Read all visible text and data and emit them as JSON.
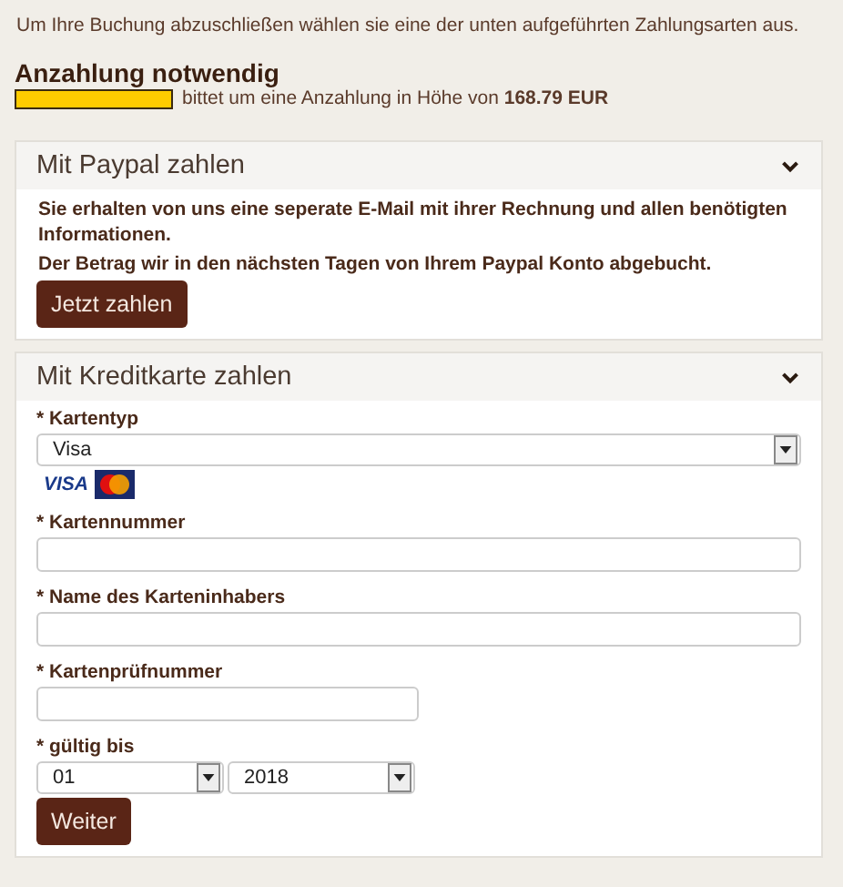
{
  "intro": "Um Ihre Buchung abzuschließen wählen sie eine der unten aufgeführten Zahlungsarten aus.",
  "deposit": {
    "title": "Anzahlung notwendig",
    "redacted": true,
    "text": "bittet um eine Anzahlung in Höhe von **168.79 EUR**"
  },
  "panels": [
    {
      "title": "Mit Paypal zahlen",
      "expanded": true,
      "paragraphs": [
        "Sie erhalten von uns eine seperate E-Mail mit ihrer Rechnung und allen benötigten Informationen.",
        "Der Betrag wir in den nächsten Tagen von Ihrem Paypal Konto abgebucht."
      ],
      "button": "Jetzt zahlen"
    },
    {
      "title": "Mit Kreditkarte zahlen",
      "expanded": true,
      "fields": [
        {
          "kind": "select",
          "label": "* Kartentyp",
          "value": "Visa"
        },
        {
          "kind": "cards",
          "visa": "VISA"
        },
        {
          "kind": "input",
          "label": "* Kartennummer"
        },
        {
          "kind": "input",
          "label": "* Name des Karteninhabers"
        },
        {
          "kind": "short-input",
          "label": "* Kartenprüfnummer"
        },
        {
          "kind": "date",
          "label": "* gültig bis",
          "month": "01",
          "year": "2018"
        }
      ],
      "button": "Weiter"
    }
  ]
}
